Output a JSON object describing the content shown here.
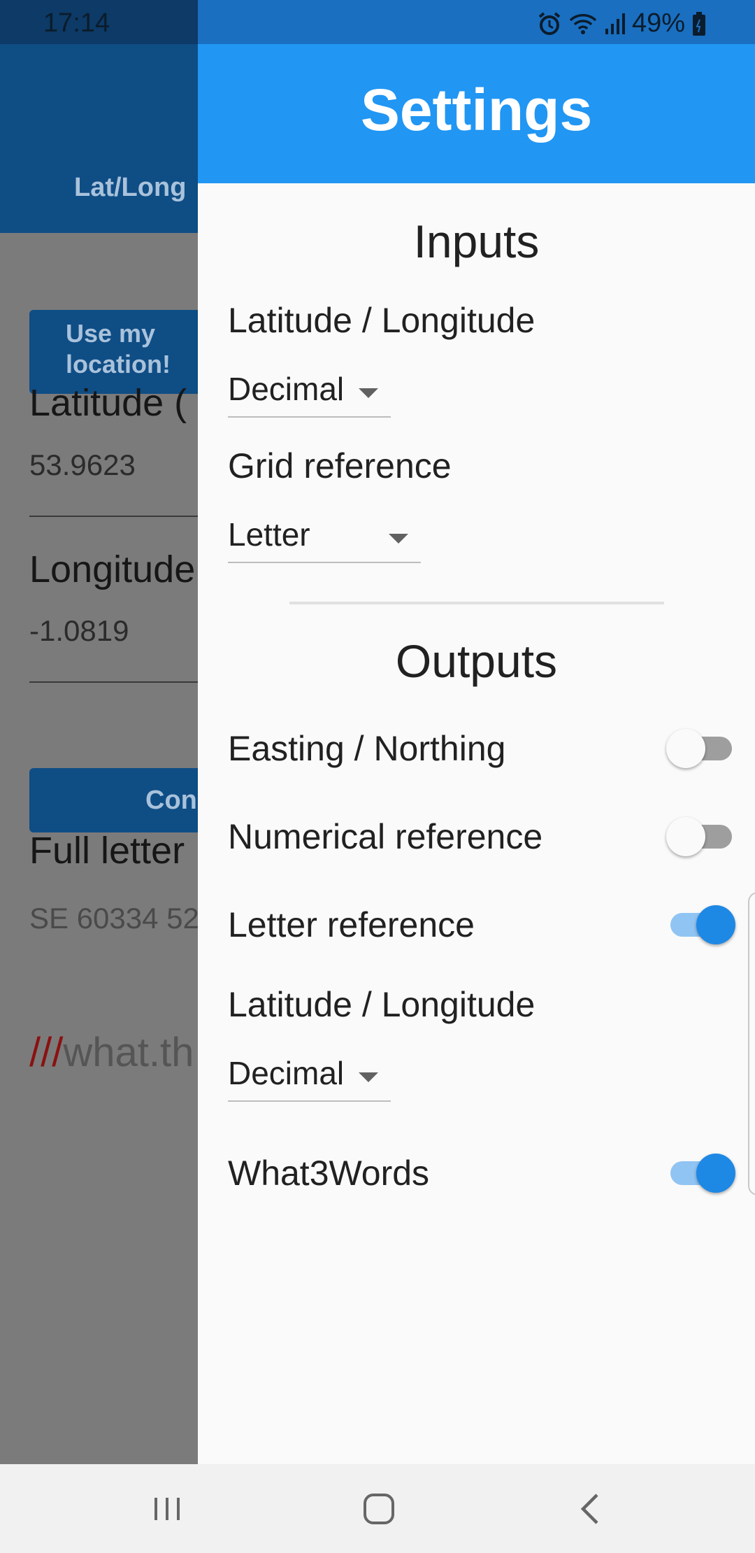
{
  "status_bar": {
    "time": "17:14",
    "battery": "49%",
    "icons": [
      "alarm-icon",
      "wifi-icon",
      "signal-icon",
      "battery-icon"
    ]
  },
  "background_app": {
    "tab_label": "Lat/Long",
    "use_location_button": "Use my location!",
    "latitude_label": "Latitude (",
    "latitude_value": "53.9623",
    "longitude_label": "Longitude",
    "longitude_value": "-1.0819",
    "convert_button": "Con",
    "full_letter_label": "Full letter",
    "full_letter_value": "SE 60334 52",
    "w3w_slashes": "///",
    "w3w_text": "what.th"
  },
  "drawer": {
    "title": "Settings",
    "inputs": {
      "heading": "Inputs",
      "latlong_label": "Latitude / Longitude",
      "latlong_value": "Decimal",
      "grid_label": "Grid reference",
      "grid_value": "Letter"
    },
    "outputs": {
      "heading": "Outputs",
      "easting_label": "Easting / Northing",
      "easting_on": false,
      "numerical_label": "Numerical reference",
      "numerical_on": false,
      "letter_label": "Letter reference",
      "letter_on": true,
      "latlong_label": "Latitude / Longitude",
      "latlong_value": "Decimal",
      "w3w_label": "What3Words",
      "w3w_on": true
    }
  },
  "colors": {
    "header": "#2196f3",
    "switch_on": "#1e88e5",
    "appbar_dim": "#0f4d85"
  }
}
